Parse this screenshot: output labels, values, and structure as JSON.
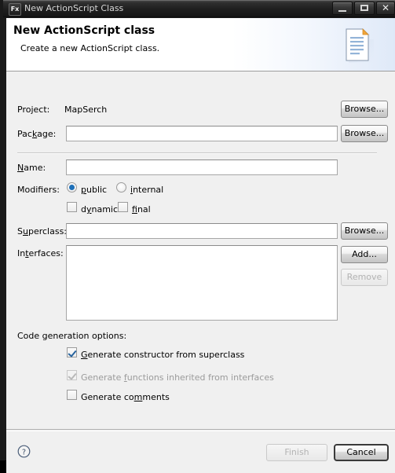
{
  "window": {
    "title": "New ActionScript Class",
    "app_icon": "Fx",
    "controls": {
      "minimize": "minimize-icon",
      "maximize": "maximize-icon",
      "close": "✕"
    }
  },
  "banner": {
    "title": "New ActionScript class",
    "subtitle": "Create a new ActionScript class.",
    "icon": "document-icon"
  },
  "form": {
    "project": {
      "label": "Project:",
      "value": "MapSerch",
      "browse_label": "Browse..."
    },
    "package": {
      "label": "Package:",
      "value": "",
      "placeholder": "",
      "browse_label": "Browse..."
    },
    "name": {
      "label": "Name:",
      "value": "",
      "placeholder": ""
    },
    "modifiers": {
      "label": "Modifiers:",
      "radios": [
        {
          "label": "public",
          "checked": true
        },
        {
          "label": "internal",
          "checked": false
        }
      ],
      "checkboxes": [
        {
          "label": "dynamic",
          "checked": false
        },
        {
          "label": "final",
          "checked": false
        }
      ]
    },
    "superclass": {
      "label": "Superclass:",
      "value": "",
      "browse_label": "Browse..."
    },
    "interfaces": {
      "label": "Interfaces:",
      "items": [],
      "add_label": "Add...",
      "remove_label": "Remove",
      "remove_enabled": false
    },
    "code_generation": {
      "label": "Code generation options:",
      "options": [
        {
          "label": "Generate constructor from superclass",
          "checked": true,
          "enabled": true
        },
        {
          "label": "Generate functions inherited from interfaces",
          "checked": true,
          "enabled": false
        },
        {
          "label": "Generate comments",
          "checked": false,
          "enabled": true
        }
      ]
    }
  },
  "footer": {
    "help_icon": "help-icon",
    "finish_label": "Finish",
    "finish_enabled": false,
    "cancel_label": "Cancel",
    "cancel_default": true
  },
  "colors": {
    "accent": "#1d6fb8",
    "check": "#27639e",
    "dialog_bg": "#f0f0f0",
    "banner_bg": "#ffffff",
    "titlebar": "#2e2e2e"
  }
}
